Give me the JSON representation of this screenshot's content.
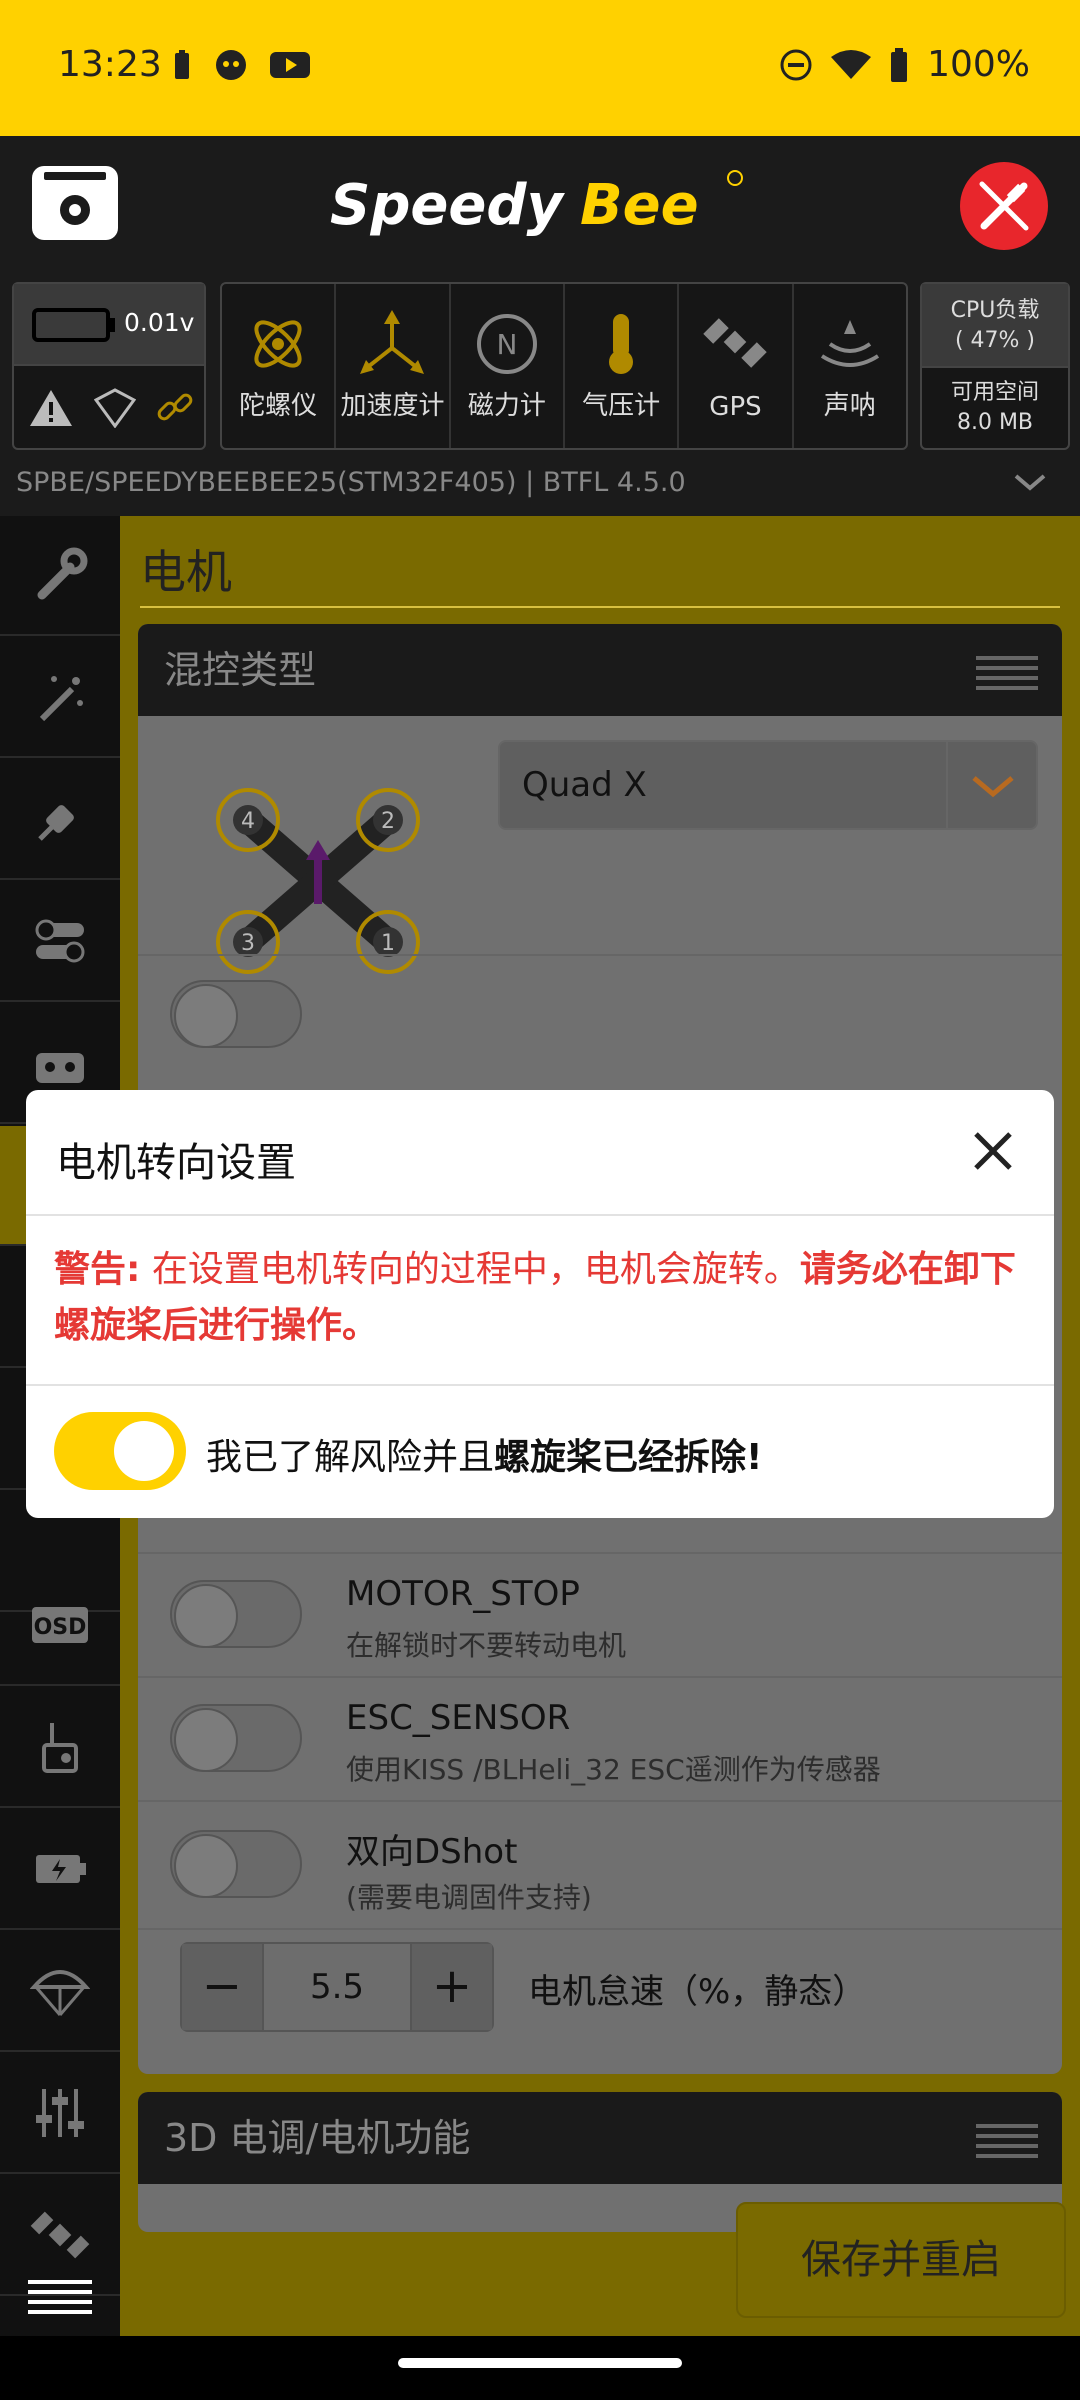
{
  "status_bar": {
    "time": "13:23",
    "battery": "100%",
    "icons_left": [
      "battery-saver-icon",
      "face-icon",
      "youtube-icon"
    ],
    "icons_right": [
      "dnd-icon",
      "wifi-icon",
      "battery-icon"
    ]
  },
  "header": {
    "logo": "SpeedyBee",
    "logo_colors": {
      "speedy": "#FFFFFF",
      "bee": "#FFD100"
    }
  },
  "sensors": {
    "voltage": "0.01v",
    "items": [
      {
        "label": "陀螺仪",
        "icon": "gyro-icon"
      },
      {
        "label": "加速度计",
        "icon": "accelerometer-icon"
      },
      {
        "label": "磁力计",
        "icon": "compass-icon"
      },
      {
        "label": "气压计",
        "icon": "barometer-icon"
      },
      {
        "label": "GPS",
        "icon": "satellite-icon"
      },
      {
        "label": "声呐",
        "icon": "sonar-icon"
      }
    ],
    "cpu_label": "CPU负载",
    "cpu_value": "( 47% )",
    "space_label": "可用空间",
    "space_value": "8.0 MB"
  },
  "device_line": "SPBE/SPEEDYBEEBEE25(STM32F405)   |   BTFL 4.5.0",
  "page": {
    "title": "电机",
    "mixer_card_title": "混控类型",
    "mixer_value": "Quad X",
    "motor_numbers": [
      "4",
      "2",
      "3",
      "1"
    ],
    "options": [
      {
        "title": "MOTOR_STOP",
        "desc": "在解锁时不要转动电机"
      },
      {
        "title": "ESC_SENSOR",
        "desc": "使用KISS /BLHeli_32 ESC遥测作为传感器"
      },
      {
        "title": "双向DShot",
        "desc": "(需要电调固件支持)"
      }
    ],
    "idle": {
      "minus": "−",
      "value": "5.5",
      "plus": "+",
      "label": "电机怠速（%，静态）"
    },
    "card3d_title": "3D 电调/电机功能",
    "save_label": "保存并重启"
  },
  "dialog": {
    "title": "电机转向设置",
    "warn_prefix": "警告:",
    "warn_text": " 在设置电机转向的过程中，电机会旋转。",
    "warn_bold": "请务必在卸下螺旋桨后进行操作。",
    "ack_text": "我已了解风险并且",
    "ack_bold": "螺旋桨已经拆除!",
    "toggle_checked": true
  },
  "colors": {
    "accent": "#FFD100",
    "warning": "#E53935",
    "disconnect": "#E8262C"
  }
}
